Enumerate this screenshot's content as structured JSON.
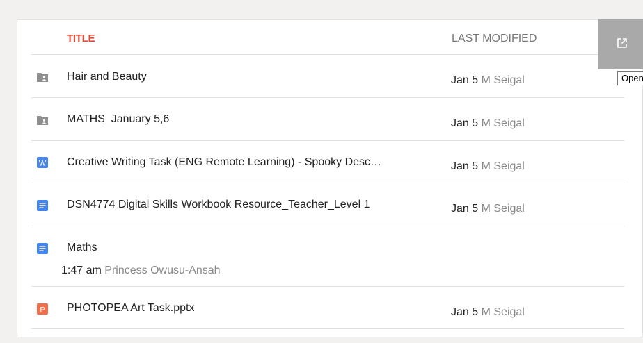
{
  "header": {
    "title_col": "TITLE",
    "modified_col": "LAST MODIFIED"
  },
  "open_button": {
    "icon": "open-in-new-icon",
    "tooltip": "Open"
  },
  "files": [
    {
      "type": "folder",
      "icon": "shared-folder-icon",
      "name": "Hair and Beauty",
      "date": "Jan 5",
      "user": "M Seigal"
    },
    {
      "type": "folder",
      "icon": "shared-folder-icon",
      "name": "MATHS_January 5,6",
      "date": "Jan 5",
      "user": "M Seigal"
    },
    {
      "type": "word",
      "icon": "word-doc-icon",
      "name": "Creative Writing Task (ENG Remote Learning) - Spooky Desc…",
      "date": "Jan 5",
      "user": "M Seigal"
    },
    {
      "type": "doc",
      "icon": "google-doc-icon",
      "name": "DSN4774 Digital Skills Workbook Resource_Teacher_Level 1",
      "date": "Jan 5",
      "user": "M Seigal"
    },
    {
      "type": "doc",
      "icon": "google-doc-icon",
      "name": "Maths",
      "date": "1:47 am",
      "user": "Princess Owusu-Ansah"
    },
    {
      "type": "ppt",
      "icon": "powerpoint-icon",
      "name": "PHOTOPEA Art Task.pptx",
      "date": "Jan 5",
      "user": "M Seigal"
    }
  ],
  "colors": {
    "title_accent": "#dd4b39",
    "folder_icon": "#8f8f8f",
    "word_icon": "#4a86e8",
    "doc_icon": "#4285f4",
    "ppt_icon": "#f0704c"
  }
}
